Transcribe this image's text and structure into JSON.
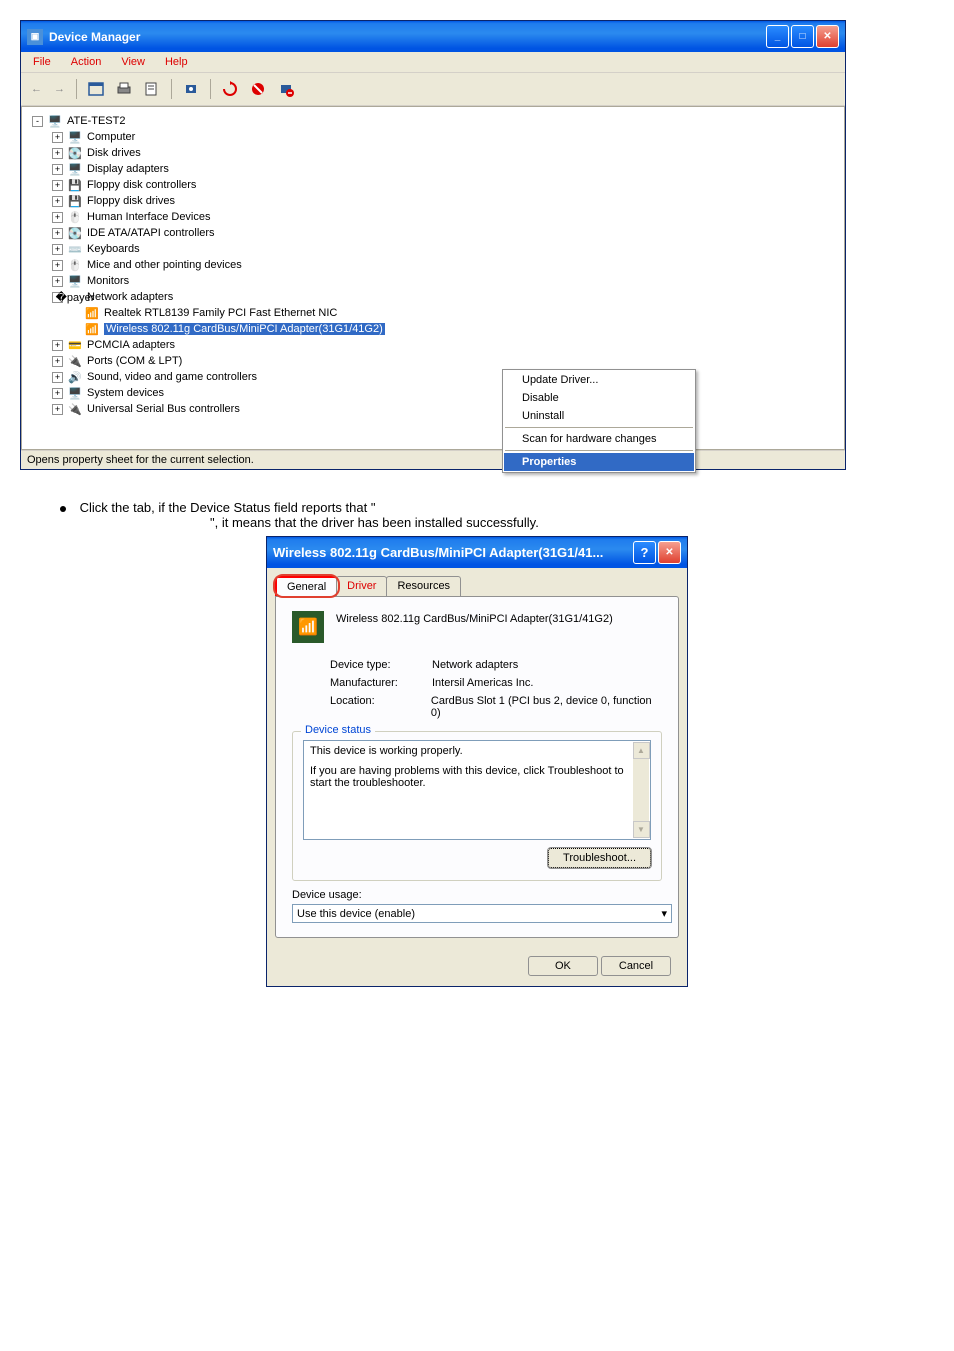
{
  "dm_window": {
    "title": "Device Manager",
    "menu": {
      "file": "File",
      "action": "Action",
      "view": "View",
      "help": "Help"
    },
    "tree": {
      "root": "ATE-TEST2",
      "items": [
        "Computer",
        "Disk drives",
        "Display adapters",
        "Floppy disk controllers",
        "Floppy disk drives",
        "Human Interface Devices",
        "IDE ATA/ATAPI controllers",
        "Keyboards",
        "Mice and other pointing devices",
        "Monitors",
        "Network adapters",
        "PCMCIA adapters",
        "Ports (COM & LPT)",
        "Sound, video and game controllers",
        "System devices",
        "Universal Serial Bus controllers"
      ],
      "network_children": [
        "Realtek RTL8139 Family PCI Fast Ethernet NIC",
        "Wireless 802.11g CardBus/MiniPCI Adapter(31G1/41G2)"
      ]
    },
    "context_menu": {
      "update": "Update Driver...",
      "disable": "Disable",
      "uninstall": "Uninstall",
      "scan": "Scan for hardware changes",
      "properties": "Properties"
    },
    "status": "Opens property sheet for the current selection."
  },
  "guide": {
    "line1_a": "Click the ",
    "line1_b": " tab, if the Device Status field reports that \"",
    "line2": "\", it means that the driver has been installed successfully."
  },
  "dialog": {
    "title": "Wireless 802.11g CardBus/MiniPCI Adapter(31G1/41...",
    "tabs": {
      "general": "General",
      "driver": "Driver",
      "resources": "Resources"
    },
    "device_name": "Wireless 802.11g CardBus/MiniPCI Adapter(31G1/41G2)",
    "props": {
      "type_label": "Device type:",
      "type_value": "Network adapters",
      "mfr_label": "Manufacturer:",
      "mfr_value": "Intersil Americas Inc.",
      "loc_label": "Location:",
      "loc_value": "CardBus Slot 1 (PCI bus 2, device 0, function 0)"
    },
    "status_legend": "Device status",
    "status_line1": "This device is working properly.",
    "status_line2": "If you are having problems with this device, click Troubleshoot to start the troubleshooter.",
    "troubleshoot": "Troubleshoot...",
    "usage_label": "Device usage:",
    "usage_value": "Use this device (enable)",
    "ok": "OK",
    "cancel": "Cancel"
  }
}
